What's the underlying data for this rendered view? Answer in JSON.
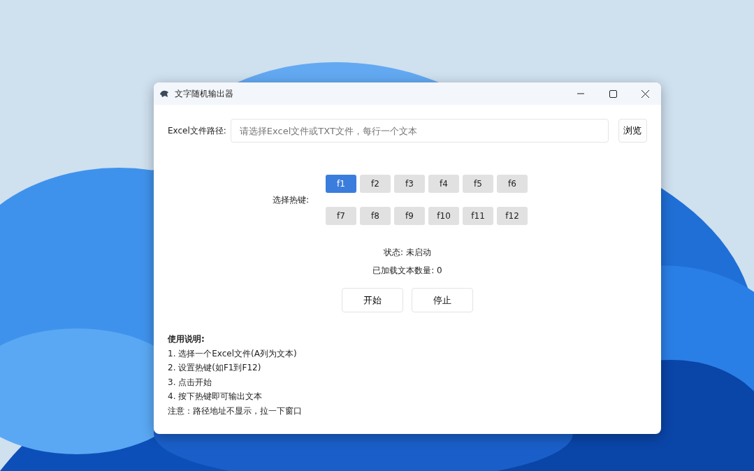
{
  "window": {
    "title": "文字随机输出器"
  },
  "file_path": {
    "label": "Excel文件路径:",
    "placeholder": "请选择Excel文件或TXT文件，每行一个文本",
    "browse_button": "浏览"
  },
  "hotkeys": {
    "label": "选择热键:",
    "keys": [
      {
        "label": "f1",
        "selected": true
      },
      {
        "label": "f2",
        "selected": false
      },
      {
        "label": "f3",
        "selected": false
      },
      {
        "label": "f4",
        "selected": false
      },
      {
        "label": "f5",
        "selected": false
      },
      {
        "label": "f6",
        "selected": false
      },
      {
        "label": "f7",
        "selected": false
      },
      {
        "label": "f8",
        "selected": false
      },
      {
        "label": "f9",
        "selected": false
      },
      {
        "label": "f10",
        "selected": false
      },
      {
        "label": "f11",
        "selected": false
      },
      {
        "label": "f12",
        "selected": false
      }
    ]
  },
  "status": "状态: 未启动",
  "loaded_count": "已加载文本数量: 0",
  "buttons": [
    "开始",
    "停止"
  ],
  "instructions": {
    "title": "使用说明:",
    "lines": [
      "1. 选择一个Excel文件(A列为文本)",
      "2. 设置热键(如F1到F12)",
      "3. 点击开始",
      "4. 按下热键即可输出文本",
      "注意：路径地址不显示，拉一下窗口"
    ]
  }
}
